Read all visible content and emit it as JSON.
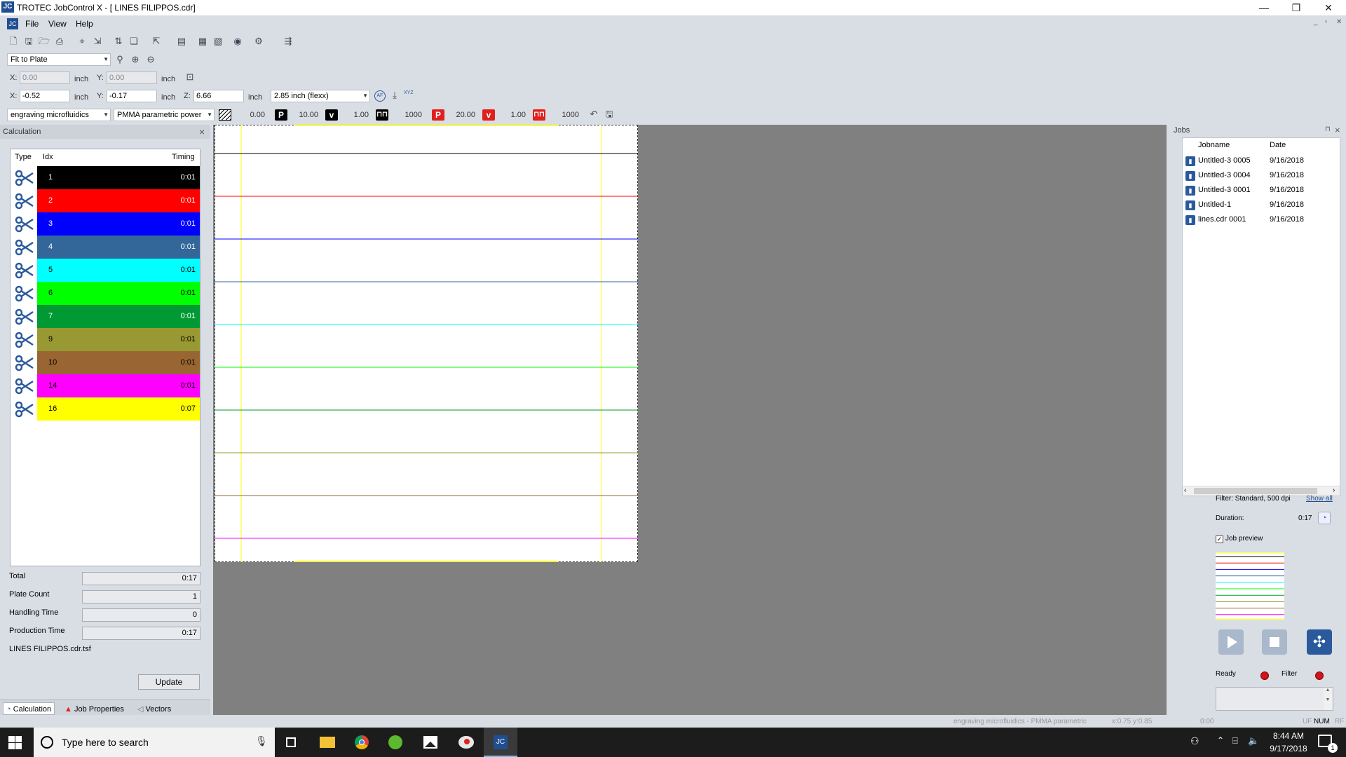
{
  "window": {
    "title": "TROTEC JobControl X - [ LINES FILIPPOS.cdr]",
    "app_icon": "JC",
    "minimize": "—",
    "restore": "❐",
    "close": "✕"
  },
  "menu": {
    "items": [
      "File",
      "View",
      "Help"
    ],
    "mdi_controls": [
      "_",
      "▫",
      "✕"
    ]
  },
  "zoom": {
    "value": "Fit to Plate"
  },
  "position_row1": {
    "x_label": "X:",
    "x_value": "0.00",
    "x_unit": "inch",
    "y_label": "Y:",
    "y_value": "0.00",
    "y_unit": "inch"
  },
  "position_row2": {
    "x_label": "X:",
    "x_value": "-0.52",
    "x_unit": "inch",
    "y_label": "Y:",
    "y_value": "-0.17",
    "y_unit": "inch",
    "z_label": "Z:",
    "z_value": "6.66",
    "z_unit": "inch",
    "lens": "2.85 inch (flexx)",
    "af_label": "AF",
    "xyz_label": "XYZ"
  },
  "material_bar": {
    "material": "engraving microfluidics",
    "process": "PMMA parametric power",
    "engrave_value": "0.00",
    "p_label": "P",
    "p_value": "10.00",
    "v_label": "v",
    "v_value": "1.00",
    "freq_value": "1000",
    "p2_label": "P",
    "p2_value": "20.00",
    "v2_label": "v",
    "v2_value": "1.00",
    "freq2_value": "1000"
  },
  "calculation": {
    "title": "Calculation",
    "close": "×",
    "headers": {
      "type": "Type",
      "idx": "Idx",
      "timing": "Timing"
    },
    "rows": [
      {
        "idx": "1",
        "timing": "0:01",
        "color": "#000000",
        "text_color": "#ffffff"
      },
      {
        "idx": "2",
        "timing": "0:01",
        "color": "#ff0000",
        "text_color": "#ffffff"
      },
      {
        "idx": "3",
        "timing": "0:01",
        "color": "#0000ff",
        "text_color": "#ffffff"
      },
      {
        "idx": "4",
        "timing": "0:01",
        "color": "#336699",
        "text_color": "#ffffff"
      },
      {
        "idx": "5",
        "timing": "0:01",
        "color": "#00ffff",
        "text_color": "#000000"
      },
      {
        "idx": "6",
        "timing": "0:01",
        "color": "#00ff00",
        "text_color": "#000000"
      },
      {
        "idx": "7",
        "timing": "0:01",
        "color": "#009933",
        "text_color": "#ffffff"
      },
      {
        "idx": "9",
        "timing": "0:01",
        "color": "#999933",
        "text_color": "#000000"
      },
      {
        "idx": "10",
        "timing": "0:01",
        "color": "#996633",
        "text_color": "#000000"
      },
      {
        "idx": "14",
        "timing": "0:01",
        "color": "#ff00ff",
        "text_color": "#000000"
      },
      {
        "idx": "16",
        "timing": "0:07",
        "color": "#ffff00",
        "text_color": "#000000"
      }
    ],
    "summary": [
      {
        "label": "Total",
        "value": "0:17"
      },
      {
        "label": "Plate Count",
        "value": "1"
      },
      {
        "label": "Handling Time",
        "value": "0"
      },
      {
        "label": "Production Time",
        "value": "0:17"
      }
    ],
    "filename": "LINES FILIPPOS.cdr.tsf",
    "update_button": "Update",
    "tabs": [
      "Calculation",
      "Job Properties",
      "Vectors"
    ]
  },
  "plate": {
    "line_colors": [
      "#000000",
      "#ff0000",
      "#0000ff",
      "#336699",
      "#00ffff",
      "#00ff00",
      "#009933",
      "#999933",
      "#996633",
      "#ff00ff"
    ],
    "vertical_line_color": "#ffff00"
  },
  "jobs": {
    "title": "Jobs",
    "pin": "⊓",
    "close": "×",
    "headers": {
      "jobname": "Jobname",
      "date": "Date"
    },
    "rows": [
      {
        "name": "Untitled-3 0005",
        "date": "9/16/2018"
      },
      {
        "name": "Untitled-3 0004",
        "date": "9/16/2018"
      },
      {
        "name": "Untitled-3 0001",
        "date": "9/16/2018"
      },
      {
        "name": "Untitled-1",
        "date": "9/16/2018"
      },
      {
        "name": "lines.cdr 0001",
        "date": "9/16/2018"
      }
    ],
    "filter_text": "Filter: Standard, 500 dpi",
    "show_all": "Show all",
    "duration_label": "Duration:",
    "duration_value": "0:17",
    "job_preview_label": "Job preview",
    "job_preview_checked": true,
    "ready_label": "Ready",
    "filter_label": "Filter"
  },
  "statusbar": {
    "material_text": "engraving microfluidics - PMMA parametric",
    "coords": "x:0.75  y:0.85",
    "time": "0:00",
    "indicators": [
      "UF",
      "NUM",
      "RF"
    ]
  },
  "taskbar": {
    "search_placeholder": "Type here to search",
    "clock_time": "8:44 AM",
    "clock_date": "9/17/2018",
    "notification_count": "1"
  }
}
